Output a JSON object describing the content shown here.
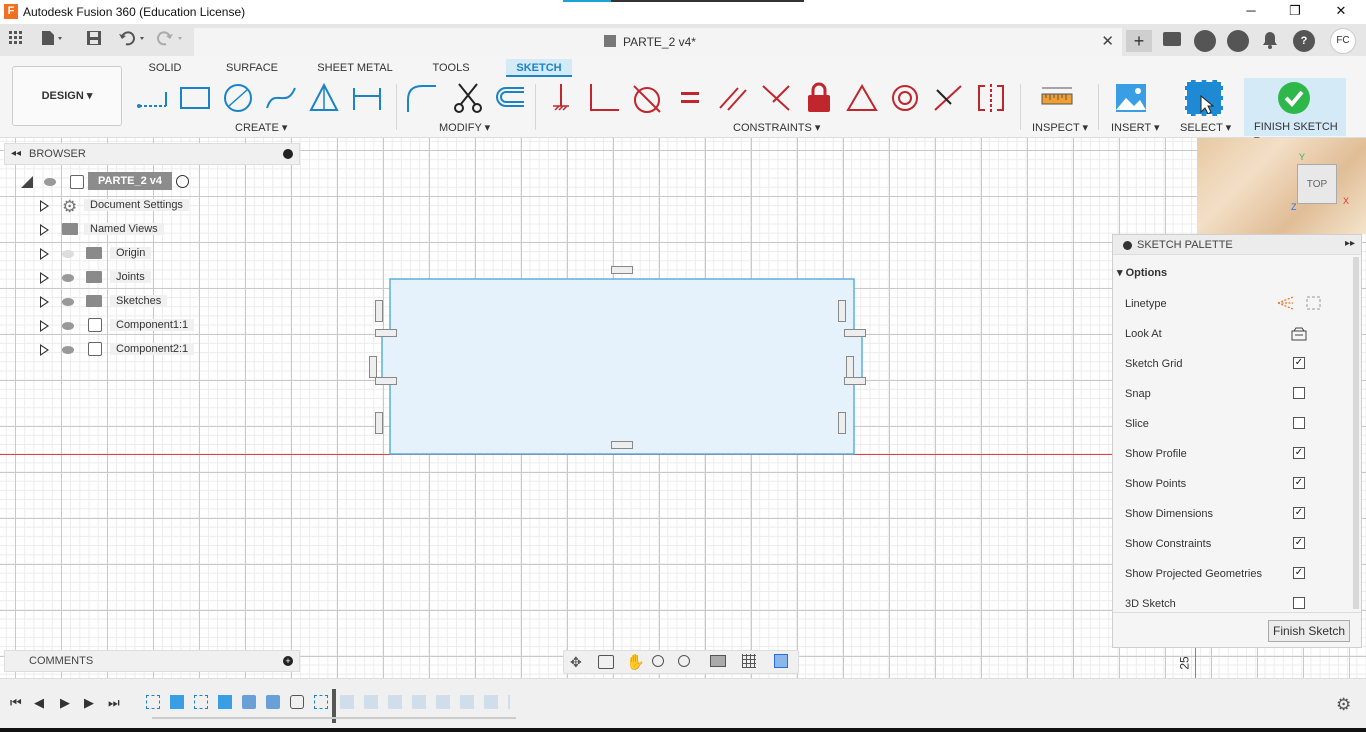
{
  "window": {
    "title": "Autodesk Fusion 360 (Education License)",
    "logo_letter": "F",
    "minimize": "─",
    "maximize": "❐",
    "close": "✕"
  },
  "tabs": {
    "document_name": "PARTE_2 v4*",
    "close_glyph": "✕",
    "new_tab_glyph": "+",
    "user_initials": "FC"
  },
  "ribbon": {
    "workspace": "DESIGN ▾",
    "tabs": [
      "SOLID",
      "SURFACE",
      "SHEET METAL",
      "TOOLS",
      "SKETCH"
    ],
    "active_tab": "SKETCH",
    "groups": {
      "create": "CREATE ▾",
      "modify": "MODIFY ▾",
      "constraints": "CONSTRAINTS ▾",
      "inspect": "INSPECT ▾",
      "insert": "INSERT ▾",
      "select": "SELECT ▾",
      "finish_sketch": "FINISH SKETCH ▾"
    },
    "accent_color": "#1a84c7",
    "finish_color": "#2fb84a"
  },
  "browser": {
    "title": "BROWSER",
    "root": "PARTE_2 v4",
    "items": [
      {
        "label": "Document Settings"
      },
      {
        "label": "Named Views"
      },
      {
        "label": "Origin"
      },
      {
        "label": "Joints"
      },
      {
        "label": "Sketches"
      },
      {
        "label": "Component1:1"
      },
      {
        "label": "Component2:1"
      }
    ]
  },
  "comments": {
    "title": "COMMENTS"
  },
  "palette": {
    "title": "SKETCH PALETTE",
    "section": "Options",
    "rows": [
      {
        "label": "Linetype",
        "checked": null
      },
      {
        "label": "Look At",
        "checked": null
      },
      {
        "label": "Sketch Grid",
        "checked": true
      },
      {
        "label": "Snap",
        "checked": false
      },
      {
        "label": "Slice",
        "checked": false
      },
      {
        "label": "Show Profile",
        "checked": true
      },
      {
        "label": "Show Points",
        "checked": true
      },
      {
        "label": "Show Dimensions",
        "checked": true
      },
      {
        "label": "Show Constraints",
        "checked": true
      },
      {
        "label": "Show Projected Geometries",
        "checked": true
      },
      {
        "label": "3D Sketch",
        "checked": false
      }
    ],
    "finish_button": "Finish Sketch"
  },
  "viewcube": {
    "face": "TOP",
    "axis_y": "Y",
    "axis_x": "X",
    "axis_z": "Z"
  },
  "canvas": {
    "ruler_label": "25",
    "axis_red": "#e04040",
    "axis_green": "#3bb24a",
    "profile_fill": "#e4f1fa",
    "profile_stroke": "#5aafe0"
  }
}
